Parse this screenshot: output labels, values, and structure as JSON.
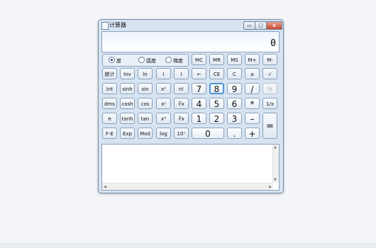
{
  "window": {
    "title": "计算器",
    "minimize": "▭",
    "maximize": "▢",
    "close": "x"
  },
  "display": {
    "value": "0"
  },
  "angle_units": [
    {
      "label": "度",
      "checked": true
    },
    {
      "label": "弧度",
      "checked": false
    },
    {
      "label": "梯度",
      "checked": false
    }
  ],
  "memory_buttons": [
    "MC",
    "MR",
    "MS",
    "M+",
    "M-"
  ],
  "buttons": {
    "stat": "統计",
    "inv": "Inv",
    "ln": "ln",
    "lparen": "(",
    "rparen": ")",
    "backspace": "←",
    "ce": "CE",
    "c": "C",
    "plusminus": "±",
    "sqrt": "√",
    "int": "Int",
    "sinh": "sinh",
    "sin": "sin",
    "x2": "x²",
    "fact": "n!",
    "seven": "7",
    "eight": "8",
    "nine": "9",
    "divide": "/",
    "percent": "%",
    "dms": "dms",
    "cosh": "cosh",
    "cos": "cos",
    "xy": "xʸ",
    "yroot": "∛x",
    "four": "4",
    "five": "5",
    "six": "6",
    "multiply": "*",
    "reciprocal": "1/x",
    "pi": "π",
    "tanh": "tanh",
    "tan": "tan",
    "x3": "x³",
    "cuberoot": "∛x",
    "one": "1",
    "two": "2",
    "three": "3",
    "minus": "–",
    "equals": "=",
    "fe": "F-E",
    "exp": "Exp",
    "mod": "Mod",
    "log": "log",
    "tenx": "10ˣ",
    "zero": "0",
    "dot": ".",
    "plus": "+"
  }
}
